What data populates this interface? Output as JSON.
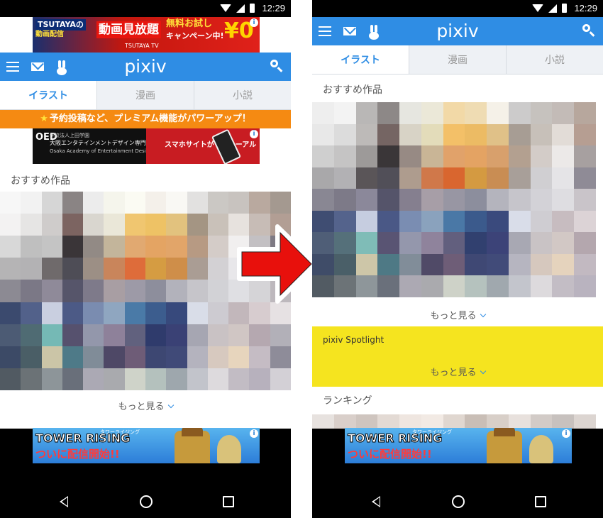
{
  "status_bar": {
    "time": "12:29"
  },
  "ad_top": {
    "brand": "TSUTAYAの",
    "brand2": "動画配信",
    "main": "動画見放題",
    "free": "無料お試し",
    "campaign": "キャンペーン中!",
    "yen": "¥0",
    "tv": "TSUTAYA TV"
  },
  "header": {
    "logo": "pixiv"
  },
  "tabs": [
    {
      "label": "イラスト",
      "active": true
    },
    {
      "label": "漫画",
      "active": false
    },
    {
      "label": "小説",
      "active": false
    }
  ],
  "promo_banner": {
    "text": "予約投稿など、プレミアム機能がパワーアップ！"
  },
  "ad_school": {
    "logo": "OED",
    "line1": "学校法人上田学園",
    "line2": "大阪エンタテインメントデザイン専門学校",
    "line3": "Osaka Academy of Entertainment Design",
    "cta": "スマホサイトがリニューアル"
  },
  "recommended": {
    "title": "おすすめ作品",
    "more": "もっと見る"
  },
  "spotlight": {
    "title": "pixiv Spotlight",
    "more": "もっと見る"
  },
  "ranking": {
    "title": "ランキング"
  },
  "ad_bottom": {
    "title1": "TOWER RISING",
    "kana": "タワーライジング",
    "title2": "ついに配信開始!!"
  },
  "mosaic_colors_left": [
    "#f7f7f7",
    "#f2f2f2",
    "#d6d6d6",
    "#8a8484",
    "#ececec",
    "#f5f5ec",
    "#fbfbf3",
    "#f4f0ea",
    "#f9f8f4",
    "#e2e1e0",
    "#cbc8c4",
    "#c8c3bf",
    "#b9a99f",
    "#a49990",
    "#f3f2f2",
    "#e6e5e4",
    "#cfcccb",
    "#7c6461",
    "#d9d6cf",
    "#eae7d8",
    "#f0c670",
    "#eec265",
    "#e2c27e",
    "#a49583",
    "#c9c1b9",
    "#e7e2de",
    "#c7bcb6",
    "#b29e94",
    "#d8d8d8",
    "#bfbfbf",
    "#c4c4c4",
    "#3a3538",
    "#928a85",
    "#c3b59b",
    "#e1a971",
    "#e4a463",
    "#e2a569",
    "#b79a83",
    "#d4ccc8",
    "#f1efef",
    "#c3c0c3",
    "#7e7a84",
    "#b5b4b5",
    "#b3b2b4",
    "#6f6a6b",
    "#4e4d56",
    "#9c8f85",
    "#c9855b",
    "#de6c3a",
    "#d59c42",
    "#cf8e49",
    "#aa9d94",
    "#d3d1d4",
    "#e8e7ea",
    "#c7c4c8",
    "#a29fa5",
    "#8c8a93",
    "#7b7886",
    "#8f8a99",
    "#56556a",
    "#7e7a8a",
    "#a89ea3",
    "#9d9aa7",
    "#8d8e9c",
    "#b2b2bb",
    "#c6c5ca",
    "#d2d2d6",
    "#dfdfe3",
    "#d5d4d7",
    "#bdb8bd",
    "#3b4a6e",
    "#52618a",
    "#c9cfe0",
    "#4c5a86",
    "#7a8cb0",
    "#8fa6c0",
    "#4a7aa7",
    "#3c5d8e",
    "#37497c",
    "#d9dde8",
    "#cdcbd1",
    "#c2b7bb",
    "#d7cccf",
    "#e6e1e3",
    "#4c5b74",
    "#4f6b73",
    "#75b9b5",
    "#56516e",
    "#9397ab",
    "#8e819a",
    "#61617e",
    "#2f3b6c",
    "#3a4175",
    "#a6a6b2",
    "#c9c2c4",
    "#d0c6c4",
    "#b5a8b0",
    "#b2b0b8",
    "#3c4a66",
    "#4a5e66",
    "#cbc5a7",
    "#4e7a88",
    "#808c98",
    "#4e4866",
    "#6e5c77",
    "#3d4772",
    "#404a78",
    "#b4b3be",
    "#d7c9bf",
    "#e7d5bd",
    "#c5bcc4",
    "#8e8c99",
    "#515a62",
    "#6b7276",
    "#8d9599",
    "#696f7a",
    "#aba9b4",
    "#a9aaae",
    "#cfd3c9",
    "#b4c1bd",
    "#9ea7ad",
    "#c2c4cb",
    "#dddadd",
    "#c2bcc4",
    "#b7b1bd",
    "#d3d0d6"
  ],
  "mosaic_colors_right": [
    "#eeeeee",
    "#f3f3f3",
    "#b9b7b6",
    "#8d8887",
    "#e6e6e0",
    "#ebe8d8",
    "#f2d9a7",
    "#efdcb3",
    "#f5f1e8",
    "#cccbcb",
    "#c6c2be",
    "#c3bbb7",
    "#b7a79d",
    "#e8e8e8",
    "#dcdcdc",
    "#bdbab8",
    "#756563",
    "#d8d3c6",
    "#e3dcba",
    "#f3c068",
    "#ecbb64",
    "#e0c188",
    "#a79d94",
    "#c7c0b9",
    "#e2dcd7",
    "#b69e92",
    "#cfcfcf",
    "#c5c4c4",
    "#9d9a99",
    "#3a3638",
    "#978a84",
    "#c9b596",
    "#e1a26a",
    "#e4a363",
    "#d8a06c",
    "#b3a090",
    "#d3ccc8",
    "#ece9e8",
    "#a7a0a0",
    "#a9a8aa",
    "#b2b1b4",
    "#5a5558",
    "#514f58",
    "#ae9c8e",
    "#d0784a",
    "#d9662f",
    "#d49a41",
    "#c98d53",
    "#a89f99",
    "#d0cfd2",
    "#e5e4e7",
    "#8f8b96",
    "#898793",
    "#7d7a88",
    "#8b889a",
    "#55546a",
    "#857f8f",
    "#a79ea7",
    "#9896a3",
    "#8c8e9d",
    "#b4b4bd",
    "#c6c5cb",
    "#d3d2d7",
    "#dedde1",
    "#c9c4c9",
    "#3f4d72",
    "#54638c",
    "#c6cde0",
    "#4a5886",
    "#7a8db2",
    "#8aa2bd",
    "#4a78a6",
    "#3b5a8c",
    "#3a4a7d",
    "#d9dde9",
    "#cfcdd2",
    "#c7bcc0",
    "#dcd3d6",
    "#4f5e77",
    "#55707a",
    "#7fbcb7",
    "#595473",
    "#9497ac",
    "#8f839c",
    "#625f7e",
    "#31406f",
    "#3c4378",
    "#a8a8b3",
    "#c9c3c5",
    "#d2c8c5",
    "#b4a7ae",
    "#3f4c68",
    "#4a5f68",
    "#cdc6a8",
    "#4e7985",
    "#818d99",
    "#504a67",
    "#6e5d77",
    "#3f4874",
    "#414b79",
    "#b6b5c0",
    "#d6c8be",
    "#e5d3bd",
    "#c2b9c1",
    "#525b63",
    "#6c7377",
    "#8e969a",
    "#6a707b",
    "#aca9b3",
    "#aaaaae",
    "#ced2c8",
    "#b5c2be",
    "#a0a8ae",
    "#c3c5cc",
    "#dddadd",
    "#c3bdc5",
    "#b9b3bf"
  ],
  "mosaic_colors_ranking": [
    "#e7e2df",
    "#d9cfca",
    "#cfc5bf",
    "#e3dad4",
    "#efe6e0",
    "#f2eae4",
    "#e0d7d0",
    "#c9beb6",
    "#d8cfc8",
    "#e8e1dd",
    "#d2cbc7",
    "#c7c1be",
    "#dcd5d1"
  ]
}
